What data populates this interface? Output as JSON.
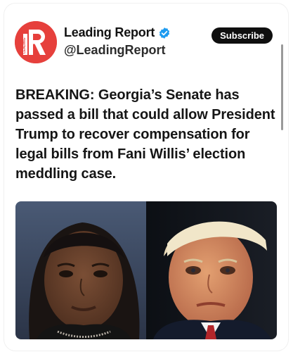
{
  "account": {
    "name": "Leading Report",
    "handle": "@LeadingReport",
    "avatar_icon": "leading-report-logo",
    "verified_icon": "verified-badge-icon",
    "brand_color": "#e6403c",
    "verified_color": "#1d9bf0"
  },
  "actions": {
    "subscribe_label": "Subscribe"
  },
  "post": {
    "headline": "BREAKING: Georgia’s Senate has passed a bill that could allow President Trump to recover compensation for legal bills from Fani Willis’ election meddling case."
  },
  "media": {
    "images": [
      "portrait-woman",
      "portrait-man"
    ]
  }
}
